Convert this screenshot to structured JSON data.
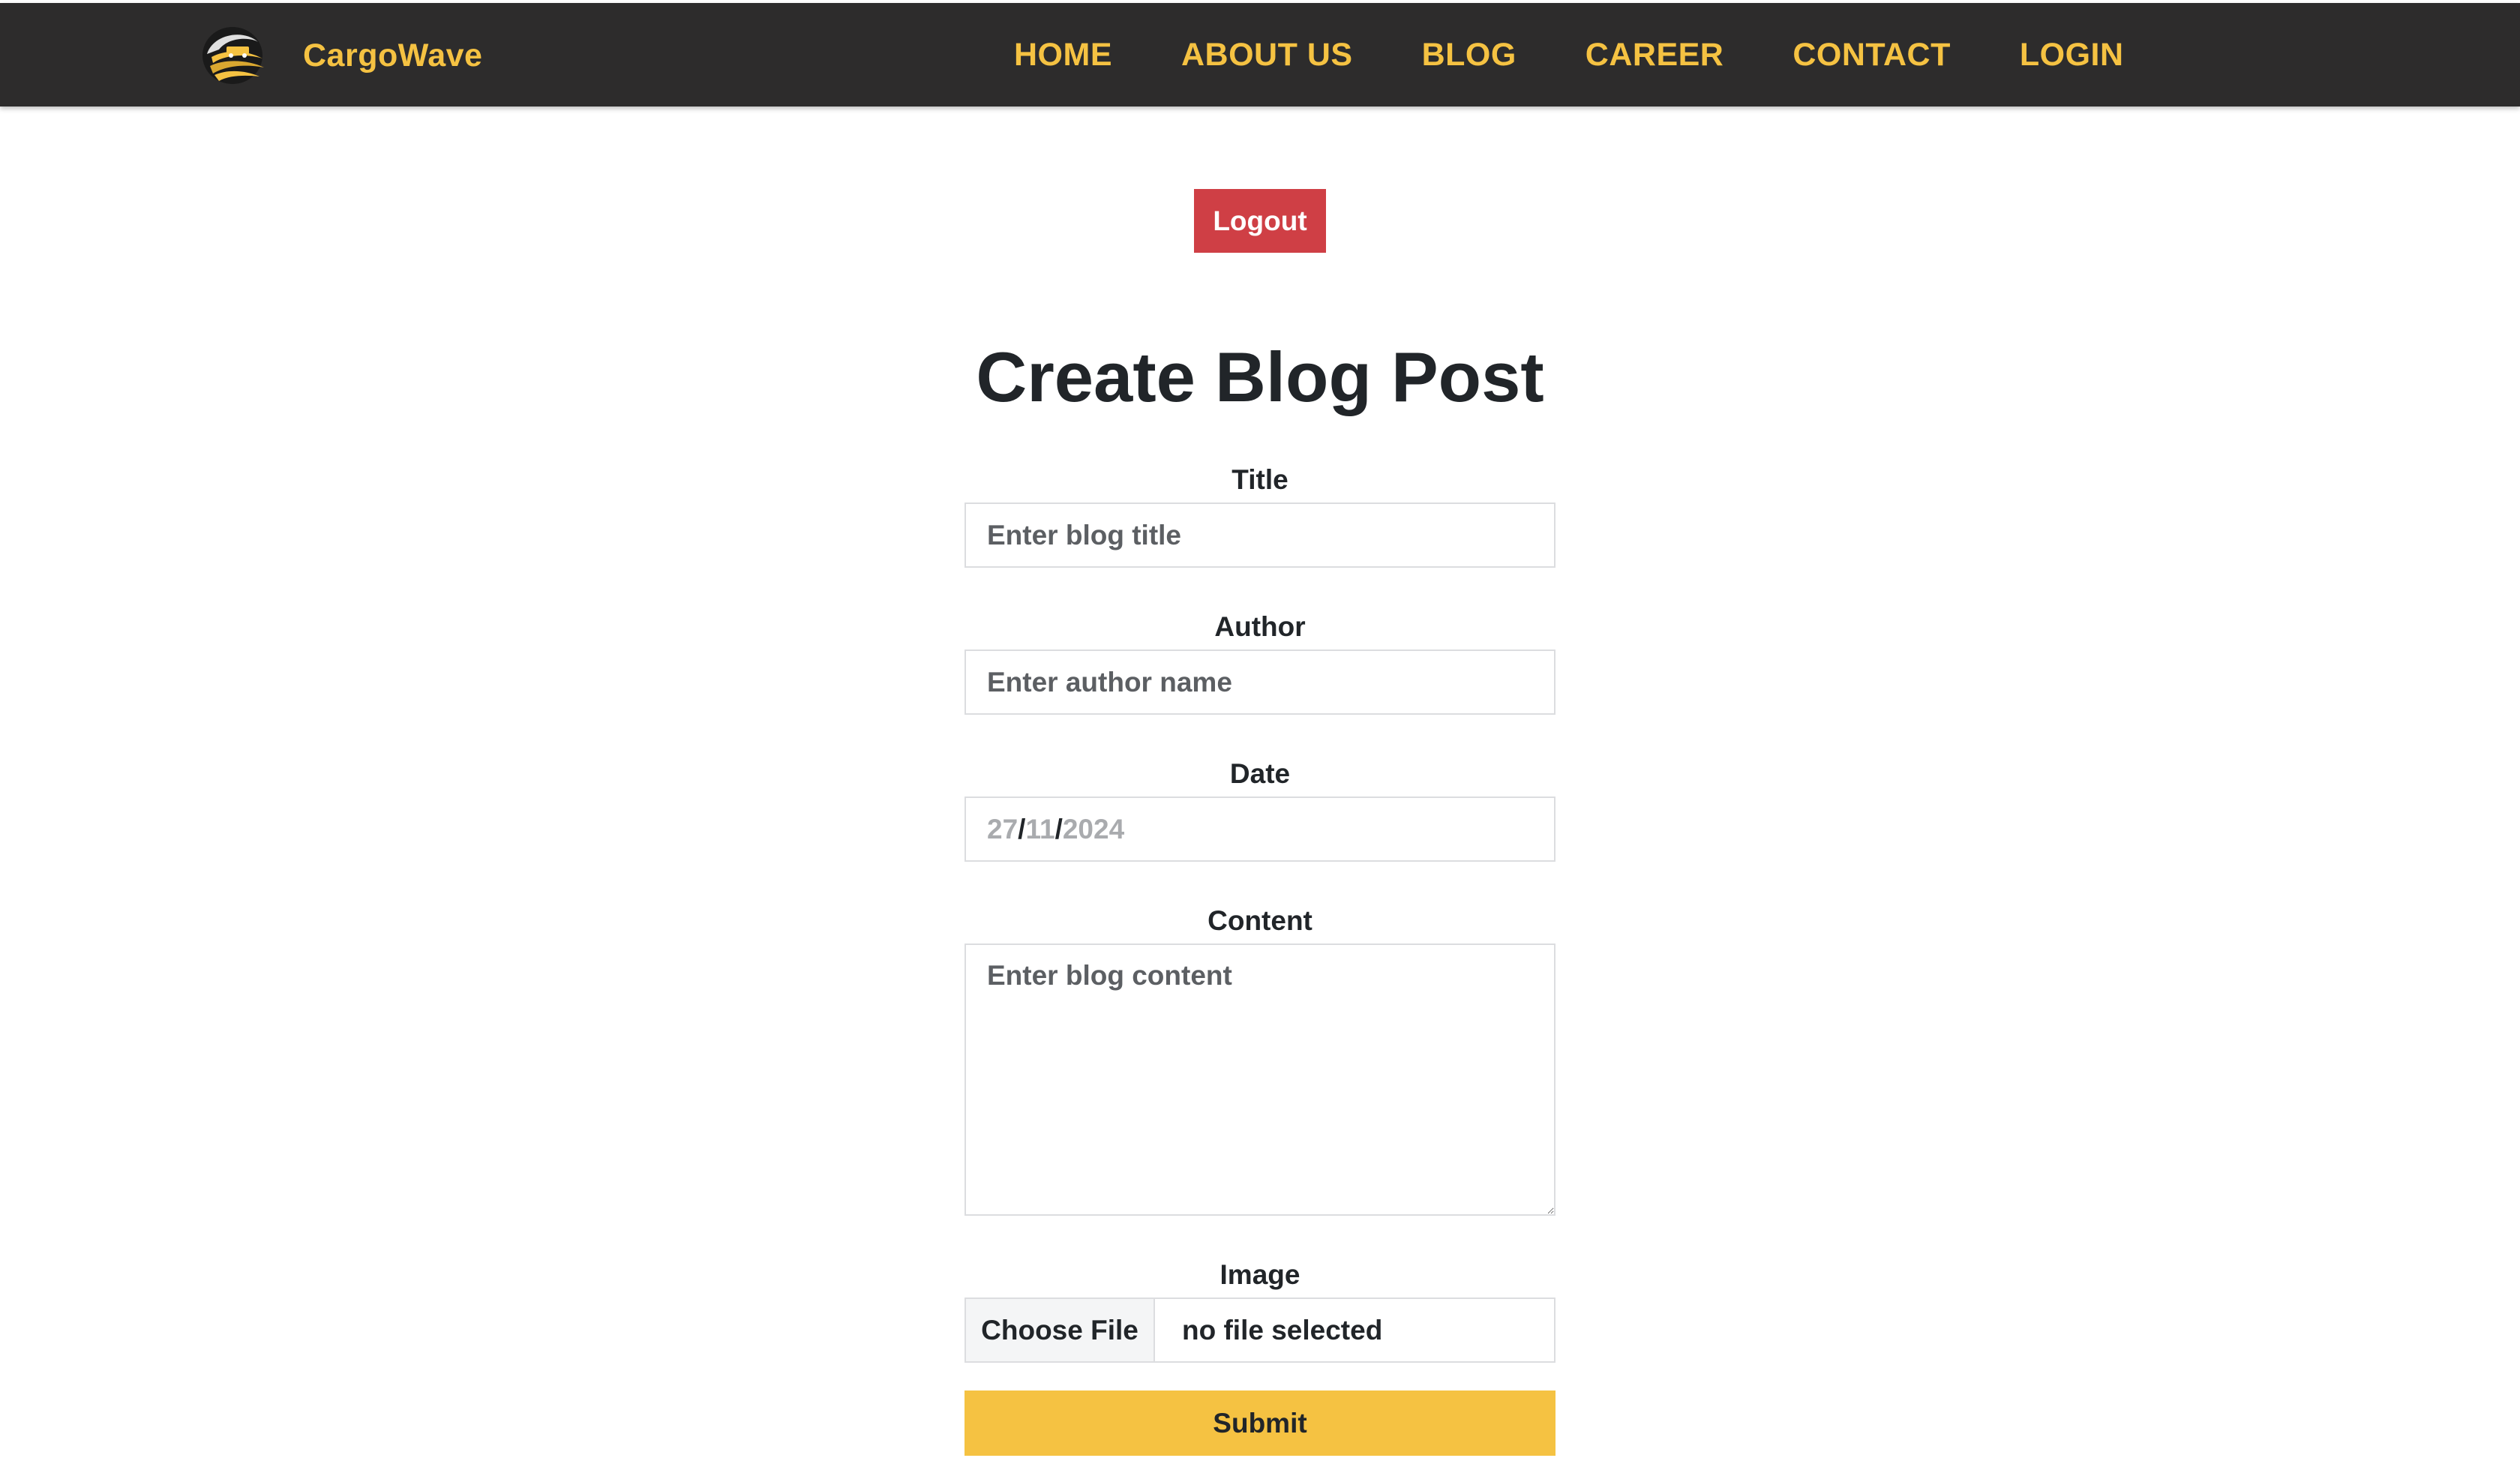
{
  "navbar": {
    "brand": "CargoWave",
    "logo_icon": "cargowave-logo-icon",
    "links": [
      {
        "label": "HOME"
      },
      {
        "label": "ABOUT US"
      },
      {
        "label": "BLOG"
      },
      {
        "label": "CAREER"
      },
      {
        "label": "CONTACT"
      },
      {
        "label": "LOGIN"
      }
    ]
  },
  "logout": {
    "label": "Logout"
  },
  "page": {
    "title": "Create Blog Post"
  },
  "form": {
    "title": {
      "label": "Title",
      "placeholder": "Enter blog title",
      "value": ""
    },
    "author": {
      "label": "Author",
      "placeholder": "Enter author name",
      "value": ""
    },
    "date": {
      "label": "Date",
      "day": "27",
      "month": "11",
      "year": "2024",
      "separator": "/"
    },
    "content": {
      "label": "Content",
      "placeholder": "Enter blog content",
      "value": ""
    },
    "image": {
      "label": "Image",
      "button_label": "Choose File",
      "status": "no file selected"
    },
    "submit": {
      "label": "Submit"
    }
  },
  "colors": {
    "nav_background": "#2d2c2c",
    "accent": "#f5c242",
    "logout": "#cf3f45",
    "text": "#212529"
  }
}
